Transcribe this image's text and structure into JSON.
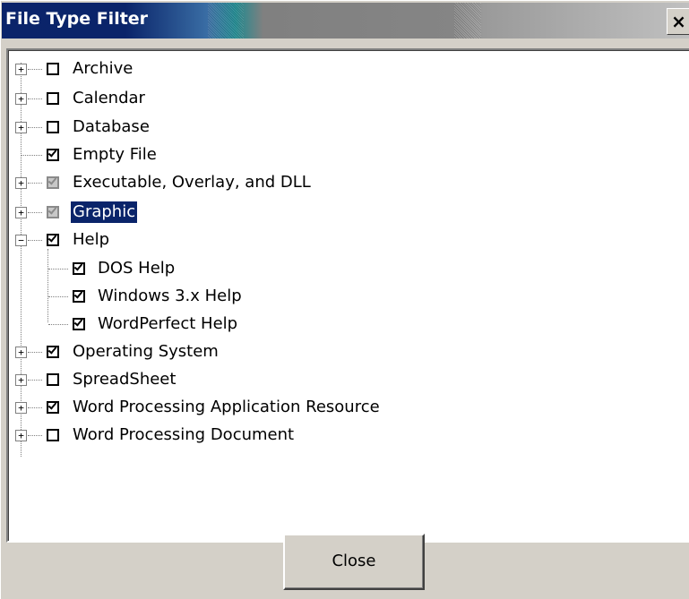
{
  "window": {
    "title": "File Type Filter",
    "close_glyph": "×"
  },
  "tree": {
    "items": [
      {
        "label": "Archive",
        "expander": "+",
        "checked": false,
        "partial": false
      },
      {
        "label": "Calendar",
        "expander": "+",
        "checked": false,
        "partial": false
      },
      {
        "label": "Database",
        "expander": "+",
        "checked": false,
        "partial": false
      },
      {
        "label": "Empty File",
        "expander": null,
        "checked": true,
        "partial": false
      },
      {
        "label": "Executable, Overlay, and DLL",
        "expander": "+",
        "checked": true,
        "partial": true
      },
      {
        "label": "Graphic",
        "expander": "+",
        "checked": true,
        "partial": true,
        "selected": true
      },
      {
        "label": "Help",
        "expander": "−",
        "checked": true,
        "partial": false,
        "children": [
          {
            "label": "DOS Help",
            "checked": true
          },
          {
            "label": "Windows 3.x Help",
            "checked": true
          },
          {
            "label": "WordPerfect Help",
            "checked": true
          }
        ]
      },
      {
        "label": "Operating System",
        "expander": "+",
        "checked": true,
        "partial": false
      },
      {
        "label": "SpreadSheet",
        "expander": "+",
        "checked": false,
        "partial": false
      },
      {
        "label": "Word Processing Application Resource",
        "expander": "+",
        "checked": true,
        "partial": false
      },
      {
        "label": "Word Processing Document",
        "expander": "+",
        "checked": false,
        "partial": false
      }
    ]
  },
  "buttons": {
    "close_label": "Close"
  },
  "colors": {
    "title_bar_active": "#0a246a",
    "selection": "#0a246a",
    "dialog_face": "#d4d0c8"
  }
}
